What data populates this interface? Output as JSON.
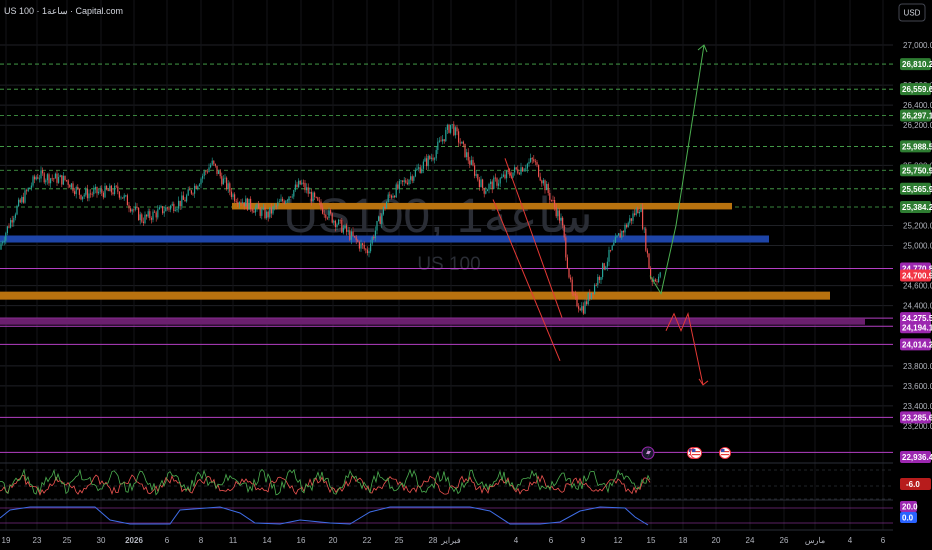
{
  "header": {
    "symbol": "US 100",
    "separator": "·",
    "interval": "1ساعة",
    "source": "Capital.com",
    "title_full": "US 100 · 1ساعة · Capital.com",
    "currency_button": "USD"
  },
  "watermark": {
    "line1": "US100, 1ساعة",
    "line2": "US 100"
  },
  "colors": {
    "background": "#000000",
    "bull": "#26a69a",
    "bear": "#ef5350",
    "grid": "#1f2126",
    "dashed_level": "#4caf50",
    "orange_zone": "#b8720f",
    "blue_zone": "#1e45a8",
    "purple_line": "#b43fc4",
    "green_arrow": "#4caf50",
    "red_arrow": "#e53935",
    "price_tag": "#f23645"
  },
  "chart_data": [
    {
      "type": "line",
      "title": "US 100 · 1ساعة · Capital.com",
      "yaxis": {
        "min": 23050,
        "max": 27150,
        "ticks": [
          "27,000.0",
          "26,600.0",
          "26,400.0",
          "26,200.0",
          "25,800.0",
          "25,200.0",
          "25,000.0",
          "24,600.0",
          "24,400.0",
          "23,800.0",
          "23,600.0",
          "23,400.0",
          "23,200.0"
        ]
      },
      "xaxis": {
        "ticks": [
          "19",
          "23",
          "25",
          "30",
          "2026",
          "6",
          "8",
          "11",
          "14",
          "16",
          "20",
          "22",
          "25",
          "28",
          "فبراير",
          "4",
          "6",
          "9",
          "12",
          "15",
          "18",
          "20",
          "24",
          "26",
          "مارس",
          "4",
          "6"
        ]
      },
      "price_series": {
        "x": [
          "Dec 17",
          "Dec 19",
          "Dec 22",
          "Dec 24",
          "Dec 26",
          "Dec 30",
          "Jan 1",
          "Jan 5",
          "Jan 7",
          "Jan 9",
          "Jan 12",
          "Jan 14",
          "Jan 16",
          "Jan 20",
          "Jan 22",
          "Jan 26",
          "Jan 28",
          "Jan 30",
          "Feb 2",
          "Feb 4",
          "Feb 5",
          "Feb 6",
          "Feb 9",
          "Feb 11",
          "Feb 12",
          "Feb 13"
        ],
        "y": [
          24960,
          25320,
          25700,
          25650,
          25510,
          25550,
          25260,
          25450,
          25820,
          25500,
          25300,
          25620,
          25420,
          24940,
          25480,
          25900,
          26210,
          25560,
          25850,
          25230,
          24480,
          24370,
          25080,
          25400,
          24660,
          24700
        ]
      },
      "dashed_levels": [
        "26,810.2",
        "26,559.6",
        "26,297.1",
        "25,988.5",
        "25,750.9",
        "25,565.9",
        "25,384.2"
      ],
      "solid_levels": [
        "24,770.8",
        "24,275.5",
        "24,194.1",
        "24,014.2",
        "23,285.6",
        "22,936.4"
      ],
      "zones": [
        {
          "name": "orange-zone-upper",
          "color": "orange",
          "y": [
            25360,
            25425
          ]
        },
        {
          "name": "blue-zone",
          "color": "blue",
          "y": [
            25030,
            25100
          ]
        },
        {
          "name": "orange-zone-lower",
          "color": "orange",
          "y": [
            24460,
            24540
          ]
        },
        {
          "name": "purple-zone",
          "color": "purple",
          "y": [
            24210,
            24275
          ]
        }
      ],
      "price_tags": [
        {
          "label": "26,810.2",
          "color": "green"
        },
        {
          "label": "26,559.6",
          "color": "green"
        },
        {
          "label": "26,297.1",
          "color": "green"
        },
        {
          "label": "25,988.5",
          "color": "green"
        },
        {
          "label": "25,750.9",
          "color": "green"
        },
        {
          "label": "25,565.9",
          "color": "green"
        },
        {
          "label": "25,384.2",
          "color": "green"
        },
        {
          "label": "24,770.8",
          "color": "purple"
        },
        {
          "label": "24,700.9",
          "color": "red"
        },
        {
          "label": "24,275.5",
          "color": "purple"
        },
        {
          "label": "24,194.1",
          "color": "purple"
        },
        {
          "label": "24,014.2",
          "color": "purple"
        },
        {
          "label": "23,285.6",
          "color": "purple"
        },
        {
          "label": "22,936.4",
          "color": "purple"
        }
      ],
      "projection_up": {
        "y": [
          24520,
          25200,
          27000
        ]
      },
      "projection_down": {
        "y": [
          24240,
          23610
        ]
      }
    },
    {
      "type": "line",
      "title": "",
      "value_tag": "-6.0",
      "ylim": [
        -100,
        100
      ]
    },
    {
      "type": "line",
      "title": "",
      "value_tags": [
        "20.0",
        "0.0"
      ],
      "ylim": [
        0,
        100
      ]
    }
  ]
}
